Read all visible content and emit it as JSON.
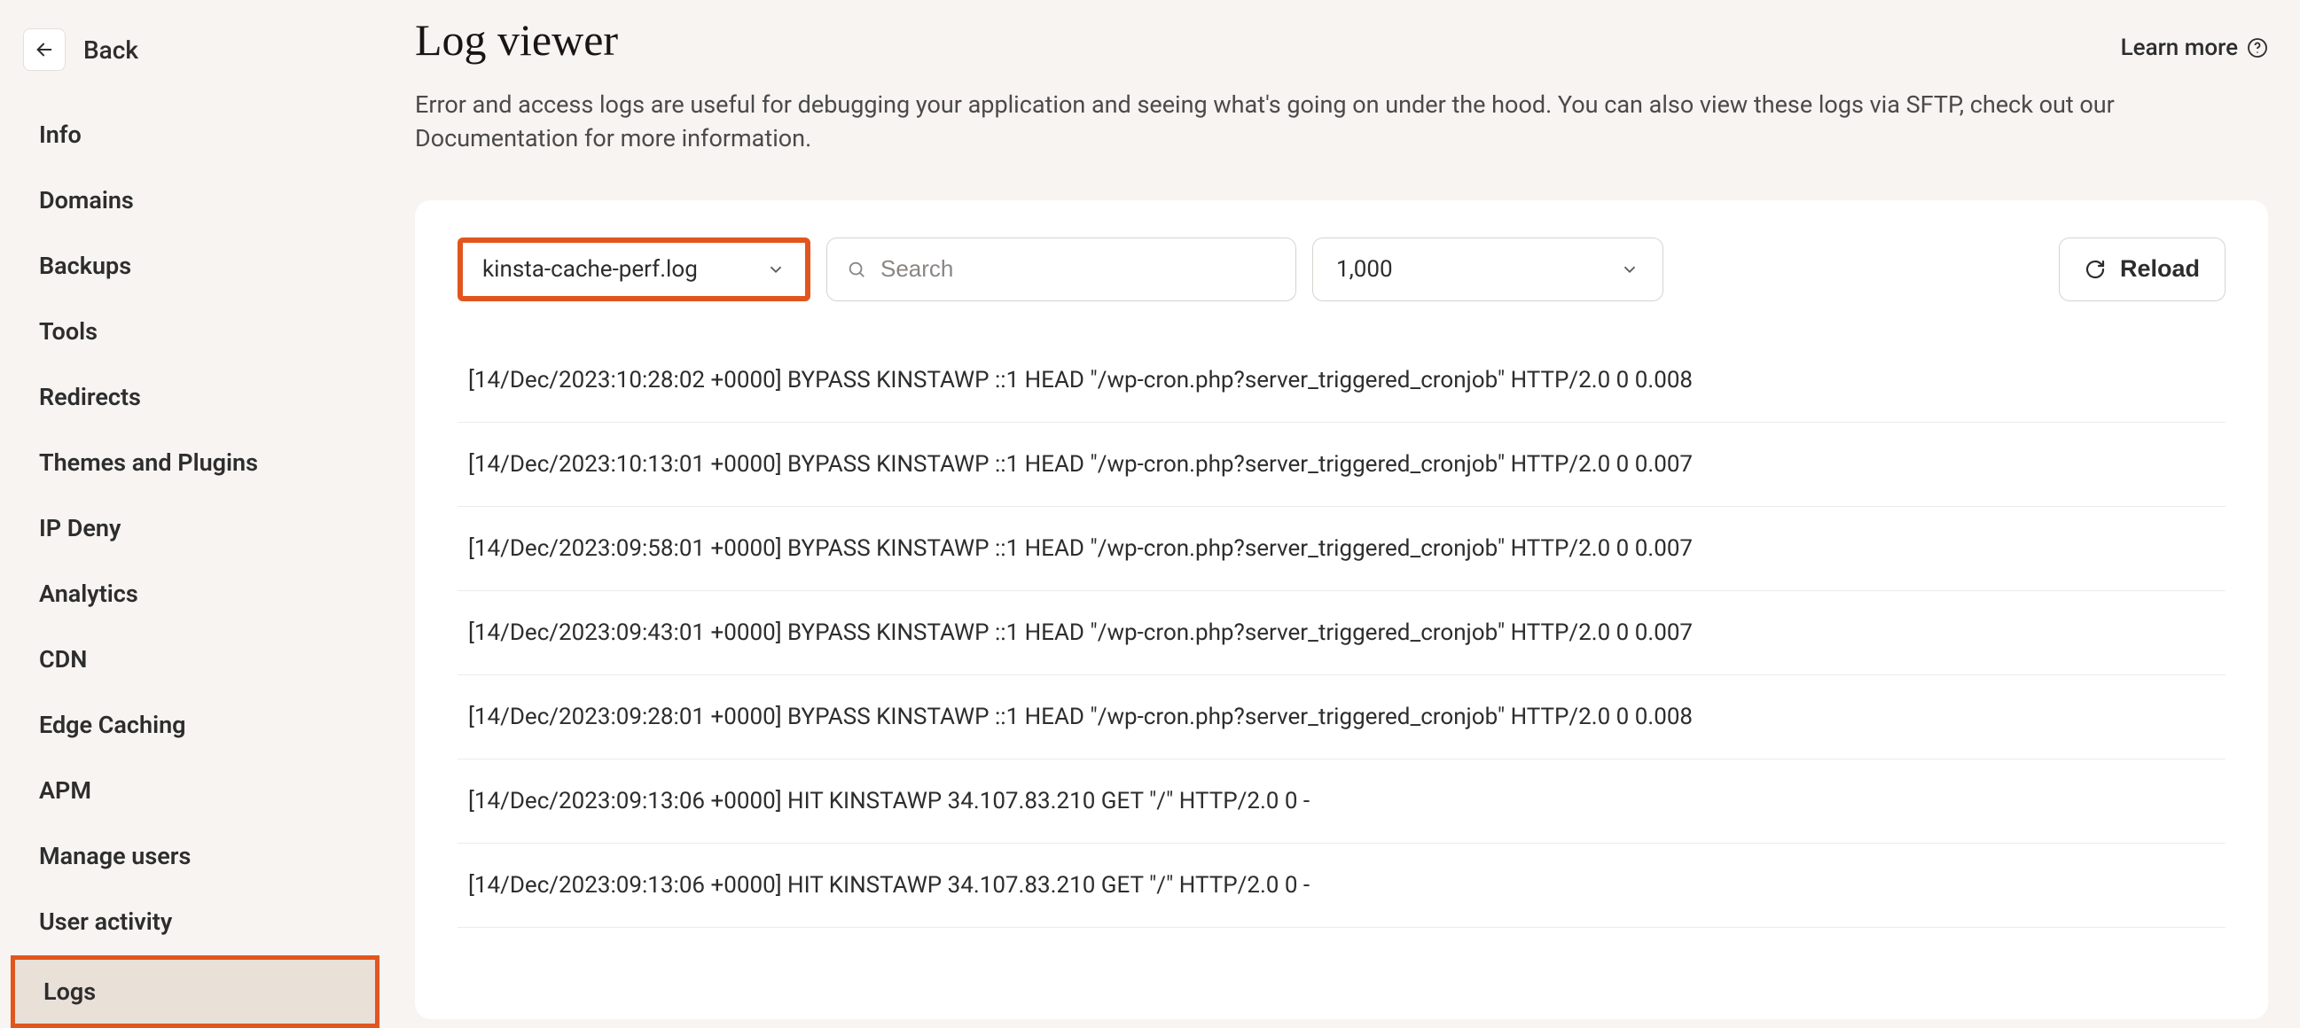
{
  "back_label": "Back",
  "sidebar": {
    "items": [
      {
        "label": "Info"
      },
      {
        "label": "Domains"
      },
      {
        "label": "Backups"
      },
      {
        "label": "Tools"
      },
      {
        "label": "Redirects"
      },
      {
        "label": "Themes and Plugins"
      },
      {
        "label": "IP Deny"
      },
      {
        "label": "Analytics"
      },
      {
        "label": "CDN"
      },
      {
        "label": "Edge Caching"
      },
      {
        "label": "APM"
      },
      {
        "label": "Manage users"
      },
      {
        "label": "User activity"
      },
      {
        "label": "Logs"
      }
    ],
    "active_index": 13
  },
  "header": {
    "title": "Log viewer",
    "learn_more": "Learn more"
  },
  "description": "Error and access logs are useful for debugging your application and seeing what's going on under the hood. You can also view these logs via SFTP, check out our Documentation for more information.",
  "controls": {
    "log_select": "kinsta-cache-perf.log",
    "search_placeholder": "Search",
    "count_select": "1,000",
    "reload_label": "Reload"
  },
  "logs": [
    "[14/Dec/2023:10:28:02 +0000] BYPASS KINSTAWP ::1 HEAD \"/wp-cron.php?server_triggered_cronjob\" HTTP/2.0 0 0.008",
    "[14/Dec/2023:10:13:01 +0000] BYPASS KINSTAWP ::1 HEAD \"/wp-cron.php?server_triggered_cronjob\" HTTP/2.0 0 0.007",
    "[14/Dec/2023:09:58:01 +0000] BYPASS KINSTAWP ::1 HEAD \"/wp-cron.php?server_triggered_cronjob\" HTTP/2.0 0 0.007",
    "[14/Dec/2023:09:43:01 +0000] BYPASS KINSTAWP ::1 HEAD \"/wp-cron.php?server_triggered_cronjob\" HTTP/2.0 0 0.007",
    "[14/Dec/2023:09:28:01 +0000] BYPASS KINSTAWP ::1 HEAD \"/wp-cron.php?server_triggered_cronjob\" HTTP/2.0 0 0.008",
    "[14/Dec/2023:09:13:06 +0000] HIT KINSTAWP 34.107.83.210 GET \"/\" HTTP/2.0 0 -",
    "[14/Dec/2023:09:13:06 +0000] HIT KINSTAWP 34.107.83.210 GET \"/\" HTTP/2.0 0 -"
  ]
}
